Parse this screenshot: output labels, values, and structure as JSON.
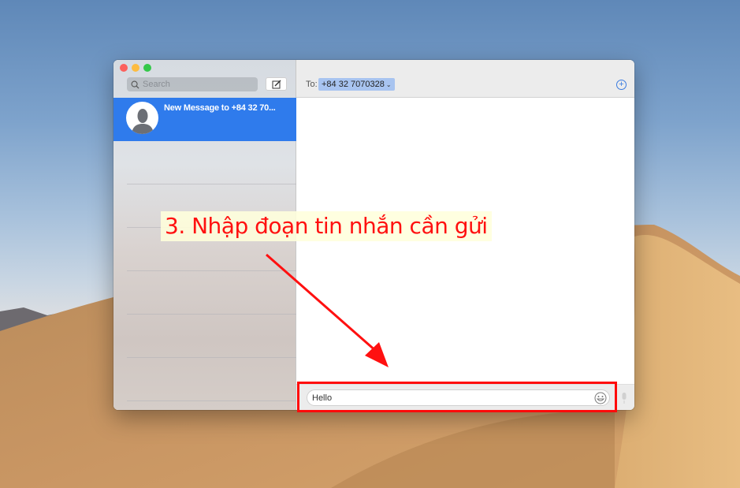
{
  "window": {
    "controls": [
      "close",
      "minimize",
      "maximize"
    ]
  },
  "sidebar": {
    "search_placeholder": "Search",
    "compose_icon": "compose-icon",
    "conversations": [
      {
        "title": "New Message to +84 32 70...",
        "avatar": "person-silhouette-icon",
        "selected": true
      }
    ]
  },
  "header": {
    "to_label": "To:",
    "recipient": "+84 32 7070328",
    "recipient_chevron": "⌄",
    "add_icon": "+"
  },
  "composer": {
    "message_value": "Hello",
    "emoji_icon": "emoji-icon",
    "mic_icon": "microphone-icon"
  },
  "annotation": {
    "callout_text": "3. Nhập đoạn tin nhắn cần gửi",
    "color": "#ff0a0a"
  }
}
